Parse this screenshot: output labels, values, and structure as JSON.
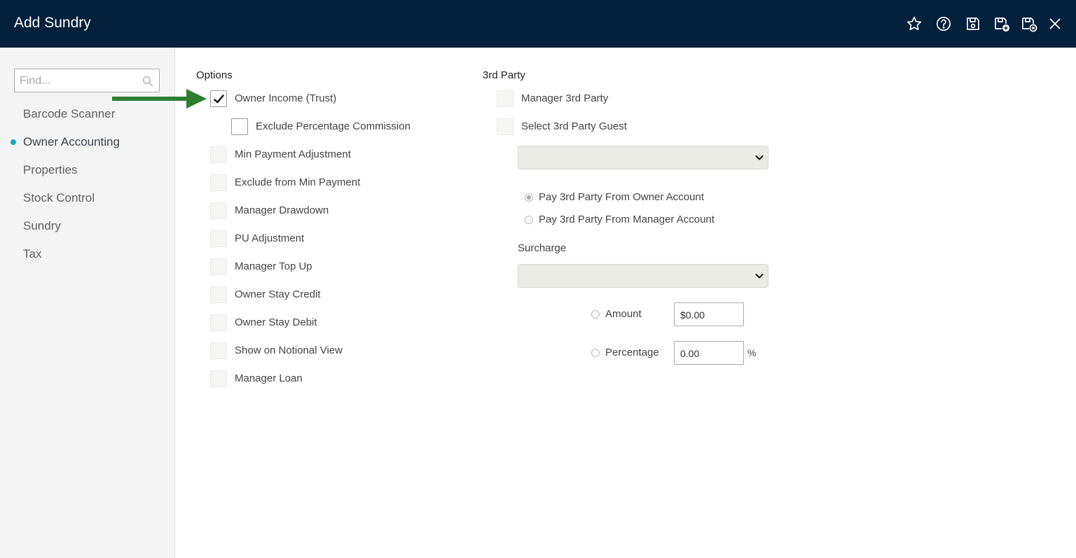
{
  "window": {
    "title": "Add Sundry"
  },
  "header_icons": [
    "star-icon",
    "help-icon",
    "save-icon",
    "save-and-new-icon",
    "save-and-close-icon",
    "close-icon"
  ],
  "colors": {
    "header": "#03203d",
    "accent_dot": "#17a9c6",
    "arrow": "#2e7d32"
  },
  "sidebar": {
    "find_placeholder": "Find...",
    "items": [
      {
        "label": "Barcode Scanner",
        "active": false
      },
      {
        "label": "Owner Accounting",
        "active": true
      },
      {
        "label": "Properties",
        "active": false
      },
      {
        "label": "Stock Control",
        "active": false
      },
      {
        "label": "Sundry",
        "active": false
      },
      {
        "label": "Tax",
        "active": false
      }
    ]
  },
  "options": {
    "title": "Options",
    "items": [
      {
        "label": "Owner Income (Trust)",
        "checked": true
      },
      {
        "label": "Exclude Percentage Commission",
        "checked": false
      },
      {
        "label": "Min Payment Adjustment",
        "checked": false
      },
      {
        "label": "Exclude from Min Payment",
        "checked": false
      },
      {
        "label": "Manager Drawdown",
        "checked": false
      },
      {
        "label": "PU Adjustment",
        "checked": false
      },
      {
        "label": "Manager Top Up",
        "checked": false
      },
      {
        "label": "Owner Stay Credit",
        "checked": false
      },
      {
        "label": "Owner Stay Debit",
        "checked": false
      },
      {
        "label": "Show on Notional View",
        "checked": false
      },
      {
        "label": "Manager Loan",
        "checked": false
      }
    ]
  },
  "third_party": {
    "title": "3rd Party",
    "manager_3rd_party": "Manager 3rd Party",
    "select_3rd_party_guest": "Select 3rd Party Guest",
    "guest_select_value": "",
    "pay_from_owner": "Pay 3rd Party From Owner Account",
    "pay_from_manager": "Pay 3rd Party From Manager Account",
    "surcharge_label": "Surcharge",
    "surcharge_select_value": "",
    "amount_label": "Amount",
    "amount_value": "$0.00",
    "percentage_label": "Percentage",
    "percentage_value": "0.00",
    "percent_symbol": "%"
  }
}
